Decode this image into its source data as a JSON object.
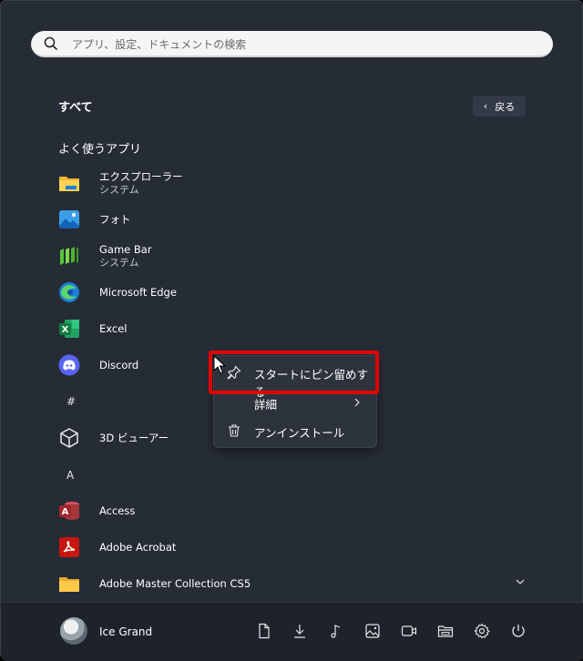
{
  "search": {
    "placeholder": "アプリ、設定、ドキュメントの検索"
  },
  "header": {
    "all_label": "すべて",
    "back_label": "戻る"
  },
  "section": {
    "frequent_title": "よく使うアプリ"
  },
  "apps": [
    {
      "name": "エクスプローラー",
      "sub": "システム",
      "icon": "file-explorer-icon"
    },
    {
      "name": "フォト",
      "icon": "photos-icon"
    },
    {
      "name": "Game Bar",
      "sub": "システム",
      "icon": "game-bar-icon"
    },
    {
      "name": "Microsoft Edge",
      "icon": "edge-icon"
    },
    {
      "name": "Excel",
      "icon": "excel-icon"
    },
    {
      "name": "Discord",
      "icon": "discord-icon"
    },
    {
      "name": "3D ビューアー",
      "icon": "3d-viewer-icon"
    },
    {
      "name": "Access",
      "icon": "access-icon"
    },
    {
      "name": "Adobe Acrobat",
      "icon": "acrobat-icon"
    },
    {
      "name": "Adobe Master Collection CS5",
      "icon": "folder-icon"
    }
  ],
  "letters": {
    "hash": "#",
    "a": "A"
  },
  "context_menu": {
    "pin": "スタートにピン留めする",
    "more": "詳細",
    "uninstall": "アンインストール"
  },
  "user": {
    "name": "Ice Grand"
  },
  "taskbar_icons": [
    "documents-icon",
    "downloads-icon",
    "music-icon",
    "pictures-icon",
    "videos-icon",
    "personal-folder-icon",
    "settings-icon",
    "power-icon"
  ],
  "colors": {
    "panel": "#262c36",
    "highlight": "#e00000",
    "accent": "#0078d4"
  }
}
